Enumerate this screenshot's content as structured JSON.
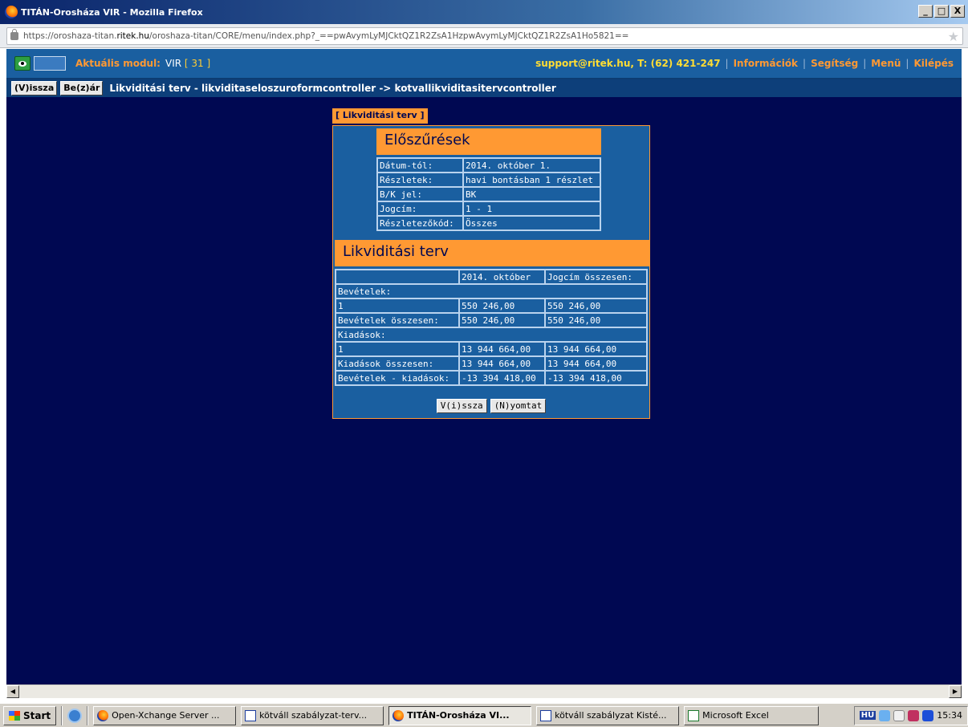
{
  "window": {
    "title": "TITÁN-Orosháza VIR - Mozilla Firefox",
    "buttons": {
      "minimize": "_",
      "maximize": "□",
      "close": "X"
    }
  },
  "browser": {
    "url_prefix": "https://oroshaza-titan.",
    "url_host": "ritek.hu",
    "url_path": "/oroshaza-titan/CORE/menu/index.php?_==pwAvymLyMJCktQZ1R2ZsA1HzpwAvymLyMJCktQZ1R2ZsA1Ho5821=="
  },
  "header": {
    "module_label": "Aktuális modul:",
    "module_name": "VIR",
    "module_number": "[ 31 ]",
    "support": "support@ritek.hu, T: (62) 421-247",
    "nav": [
      "Információk",
      "Segítség",
      "Menü",
      "Kilépés"
    ]
  },
  "subbar": {
    "back_button": "(V)issza",
    "close_button": "Be(z)ár",
    "breadcrumb": "Likviditási terv - likviditaseloszuroformcontroller -> kotvallikviditasitervcontroller"
  },
  "panel": {
    "tab_label": "[ Likviditási terv ]",
    "prefilters": {
      "title": "Előszűrések",
      "rows": [
        {
          "label": "Dátum-tól:",
          "value": "2014. október 1."
        },
        {
          "label": "Részletek:",
          "value": "havi bontásban 1 részlet"
        },
        {
          "label": "B/K jel:",
          "value": "BK"
        },
        {
          "label": "Jogcím:",
          "value": "1 - 1"
        },
        {
          "label": "Részletezőkód:",
          "value": "Összes"
        }
      ]
    },
    "plan": {
      "title": "Likviditási terv",
      "columns": [
        "",
        "2014. október",
        "Jogcím összesen:"
      ],
      "rows": [
        {
          "type": "section",
          "label": "Bevételek:"
        },
        {
          "type": "data",
          "cells": [
            "1",
            "550 246,00",
            "550 246,00"
          ]
        },
        {
          "type": "data",
          "cells": [
            "Bevételek összesen:",
            "550 246,00",
            "550 246,00"
          ]
        },
        {
          "type": "section",
          "label": "Kiadások:"
        },
        {
          "type": "data",
          "cells": [
            "1",
            "13 944 664,00",
            "13 944 664,00"
          ]
        },
        {
          "type": "data",
          "cells": [
            "Kiadások összesen:",
            "13 944 664,00",
            "13 944 664,00"
          ]
        },
        {
          "type": "data",
          "cells": [
            "Bevételek - kiadások:",
            "-13 394 418,00",
            "-13 394 418,00"
          ]
        }
      ]
    },
    "actions": {
      "back": "V(i)ssza",
      "print": "(N)yomtat"
    }
  },
  "taskbar": {
    "start": "Start",
    "tasks": [
      {
        "label": "Open-Xchange Server ...",
        "icon": "firefox-icon",
        "active": false
      },
      {
        "label": "kötváll szabályzat-terv...",
        "icon": "word-icon",
        "active": false
      },
      {
        "label": "TITÁN-Orosháza VI...",
        "icon": "firefox-icon",
        "active": true
      },
      {
        "label": "kötváll szabályzat Kisté...",
        "icon": "word-icon",
        "active": false
      },
      {
        "label": "Microsoft Excel",
        "icon": "excel-icon",
        "active": false
      }
    ],
    "tray": {
      "lang": "HU",
      "clock": "15:34"
    }
  }
}
